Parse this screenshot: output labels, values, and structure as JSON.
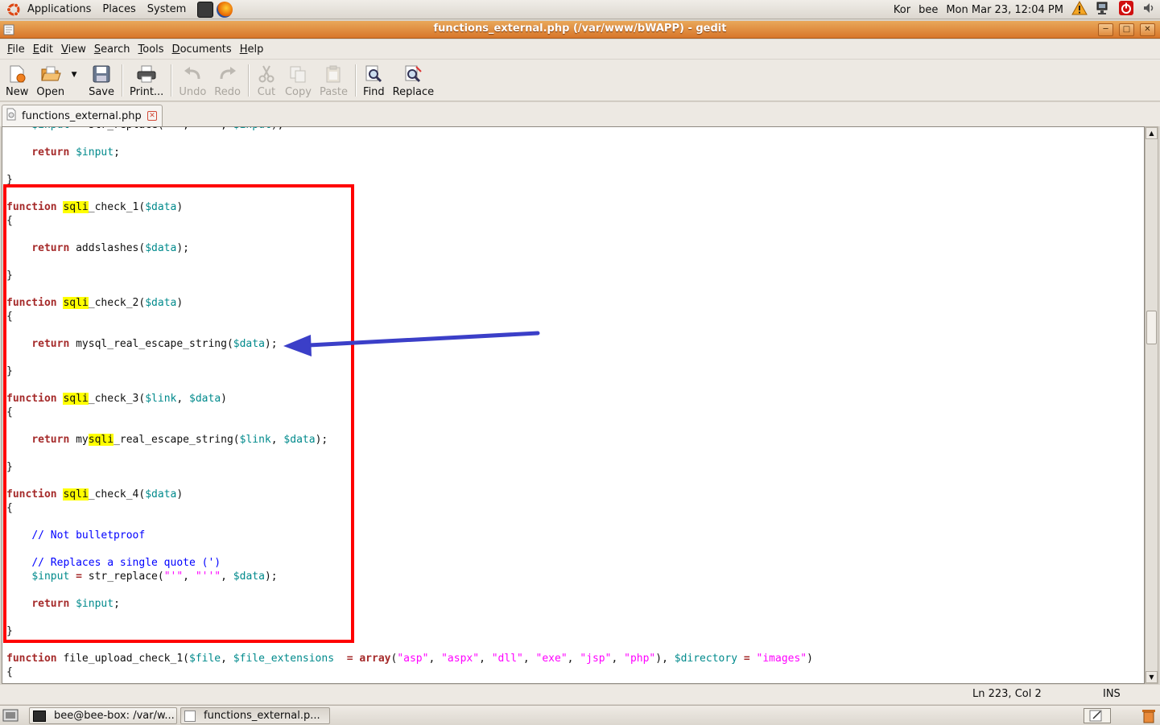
{
  "top_panel": {
    "menus": [
      "Applications",
      "Places",
      "System"
    ],
    "user": "Kor",
    "username": "bee",
    "clock": "Mon Mar 23, 12:04 PM"
  },
  "window": {
    "title": "functions_external.php (/var/www/bWAPP) - gedit"
  },
  "menubar": {
    "items": [
      {
        "mnemonic": "F",
        "rest": "ile"
      },
      {
        "mnemonic": "E",
        "rest": "dit"
      },
      {
        "mnemonic": "V",
        "rest": "iew"
      },
      {
        "mnemonic": "S",
        "rest": "earch"
      },
      {
        "mnemonic": "T",
        "rest": "ools"
      },
      {
        "mnemonic": "D",
        "rest": "ocuments"
      },
      {
        "mnemonic": "H",
        "rest": "elp"
      }
    ]
  },
  "toolbar": {
    "new": "New",
    "open": "Open",
    "save": "Save",
    "print": "Print...",
    "undo": "Undo",
    "redo": "Redo",
    "cut": "Cut",
    "copy": "Copy",
    "paste": "Paste",
    "find": "Find",
    "replace": "Replace"
  },
  "tab": {
    "label": "functions_external.php"
  },
  "code_lines": [
    [
      {
        "t": "    "
      },
      {
        "c": "var",
        "t": "$input"
      },
      {
        "t": " = str_replace(\"'\", \"''\", "
      },
      {
        "c": "var",
        "t": "$input"
      },
      {
        "t": ");"
      }
    ],
    [
      {
        "t": ""
      }
    ],
    [
      {
        "t": "    "
      },
      {
        "c": "kw",
        "t": "return"
      },
      {
        "t": " "
      },
      {
        "c": "var",
        "t": "$input"
      },
      {
        "t": ";"
      }
    ],
    [
      {
        "t": ""
      }
    ],
    [
      {
        "t": "}"
      }
    ],
    [
      {
        "t": ""
      }
    ],
    [
      {
        "c": "kw",
        "t": "function"
      },
      {
        "t": " "
      },
      {
        "c": "hl",
        "t": "sqli"
      },
      {
        "t": "_check_1("
      },
      {
        "c": "var",
        "t": "$data"
      },
      {
        "t": ")"
      }
    ],
    [
      {
        "t": "{"
      }
    ],
    [
      {
        "t": ""
      }
    ],
    [
      {
        "t": "    "
      },
      {
        "c": "kw",
        "t": "return"
      },
      {
        "t": " addslashes("
      },
      {
        "c": "var",
        "t": "$data"
      },
      {
        "t": ");"
      }
    ],
    [
      {
        "t": ""
      }
    ],
    [
      {
        "t": "}"
      }
    ],
    [
      {
        "t": ""
      }
    ],
    [
      {
        "c": "kw",
        "t": "function"
      },
      {
        "t": " "
      },
      {
        "c": "hl",
        "t": "sqli"
      },
      {
        "t": "_check_2("
      },
      {
        "c": "var",
        "t": "$data"
      },
      {
        "t": ")"
      }
    ],
    [
      {
        "t": "{"
      }
    ],
    [
      {
        "t": ""
      }
    ],
    [
      {
        "t": "    "
      },
      {
        "c": "kw",
        "t": "return"
      },
      {
        "t": " mysql_real_escape_string("
      },
      {
        "c": "var",
        "t": "$data"
      },
      {
        "t": ");"
      }
    ],
    [
      {
        "t": ""
      }
    ],
    [
      {
        "t": "}"
      }
    ],
    [
      {
        "t": ""
      }
    ],
    [
      {
        "c": "kw",
        "t": "function"
      },
      {
        "t": " "
      },
      {
        "c": "hl",
        "t": "sqli"
      },
      {
        "t": "_check_3("
      },
      {
        "c": "var",
        "t": "$link"
      },
      {
        "t": ", "
      },
      {
        "c": "var",
        "t": "$data"
      },
      {
        "t": ")"
      }
    ],
    [
      {
        "t": "{"
      }
    ],
    [
      {
        "t": ""
      }
    ],
    [
      {
        "t": "    "
      },
      {
        "c": "kw",
        "t": "return"
      },
      {
        "t": " my"
      },
      {
        "c": "hl",
        "t": "sqli"
      },
      {
        "t": "_real_escape_string("
      },
      {
        "c": "var",
        "t": "$link"
      },
      {
        "t": ", "
      },
      {
        "c": "var",
        "t": "$data"
      },
      {
        "t": ");"
      }
    ],
    [
      {
        "t": ""
      }
    ],
    [
      {
        "t": "}"
      }
    ],
    [
      {
        "t": ""
      }
    ],
    [
      {
        "c": "kw",
        "t": "function"
      },
      {
        "t": " "
      },
      {
        "c": "hl",
        "t": "sqli"
      },
      {
        "t": "_check_4("
      },
      {
        "c": "var",
        "t": "$data"
      },
      {
        "t": ")"
      }
    ],
    [
      {
        "t": "{"
      }
    ],
    [
      {
        "t": ""
      }
    ],
    [
      {
        "t": "    "
      },
      {
        "c": "cm",
        "t": "// Not bulletproof"
      }
    ],
    [
      {
        "t": ""
      }
    ],
    [
      {
        "t": "    "
      },
      {
        "c": "cm",
        "t": "// Replaces a single quote (')"
      }
    ],
    [
      {
        "t": "    "
      },
      {
        "c": "var",
        "t": "$input"
      },
      {
        "t": " "
      },
      {
        "c": "kw",
        "t": "="
      },
      {
        "t": " str_replace("
      },
      {
        "c": "str",
        "t": "\"'\""
      },
      {
        "t": ", "
      },
      {
        "c": "str",
        "t": "\"''\""
      },
      {
        "t": ", "
      },
      {
        "c": "var",
        "t": "$data"
      },
      {
        "t": ");"
      }
    ],
    [
      {
        "t": ""
      }
    ],
    [
      {
        "t": "    "
      },
      {
        "c": "kw",
        "t": "return"
      },
      {
        "t": " "
      },
      {
        "c": "var",
        "t": "$input"
      },
      {
        "t": ";"
      }
    ],
    [
      {
        "t": ""
      }
    ],
    [
      {
        "t": "}"
      }
    ],
    [
      {
        "t": ""
      }
    ],
    [
      {
        "c": "kw",
        "t": "function"
      },
      {
        "t": " file_upload_check_1("
      },
      {
        "c": "var",
        "t": "$file"
      },
      {
        "t": ", "
      },
      {
        "c": "var",
        "t": "$file_extensions"
      },
      {
        "t": "  "
      },
      {
        "c": "kw",
        "t": "="
      },
      {
        "t": " "
      },
      {
        "c": "kw",
        "t": "array"
      },
      {
        "t": "("
      },
      {
        "c": "str",
        "t": "\"asp\""
      },
      {
        "t": ", "
      },
      {
        "c": "str",
        "t": "\"aspx\""
      },
      {
        "t": ", "
      },
      {
        "c": "str",
        "t": "\"dll\""
      },
      {
        "t": ", "
      },
      {
        "c": "str",
        "t": "\"exe\""
      },
      {
        "t": ", "
      },
      {
        "c": "str",
        "t": "\"jsp\""
      },
      {
        "t": ", "
      },
      {
        "c": "str",
        "t": "\"php\""
      },
      {
        "t": "), "
      },
      {
        "c": "var",
        "t": "$directory"
      },
      {
        "t": " "
      },
      {
        "c": "kw",
        "t": "="
      },
      {
        "t": " "
      },
      {
        "c": "str",
        "t": "\"images\""
      },
      {
        "t": ")"
      }
    ],
    [
      {
        "t": "{"
      }
    ]
  ],
  "statusbar": {
    "position": "Ln 223, Col 2",
    "mode": "INS"
  },
  "taskbar": {
    "terminal": "bee@bee-box: /var/w...",
    "gedit": "functions_external.p..."
  },
  "colors": {
    "keyword": "#a52a2a",
    "variable": "#008a8c",
    "string": "#ff00ff",
    "comment": "#0000ff",
    "search_highlight": "#ffff00",
    "annotation_box": "#ff0000",
    "annotation_arrow": "#3b3fc8"
  }
}
